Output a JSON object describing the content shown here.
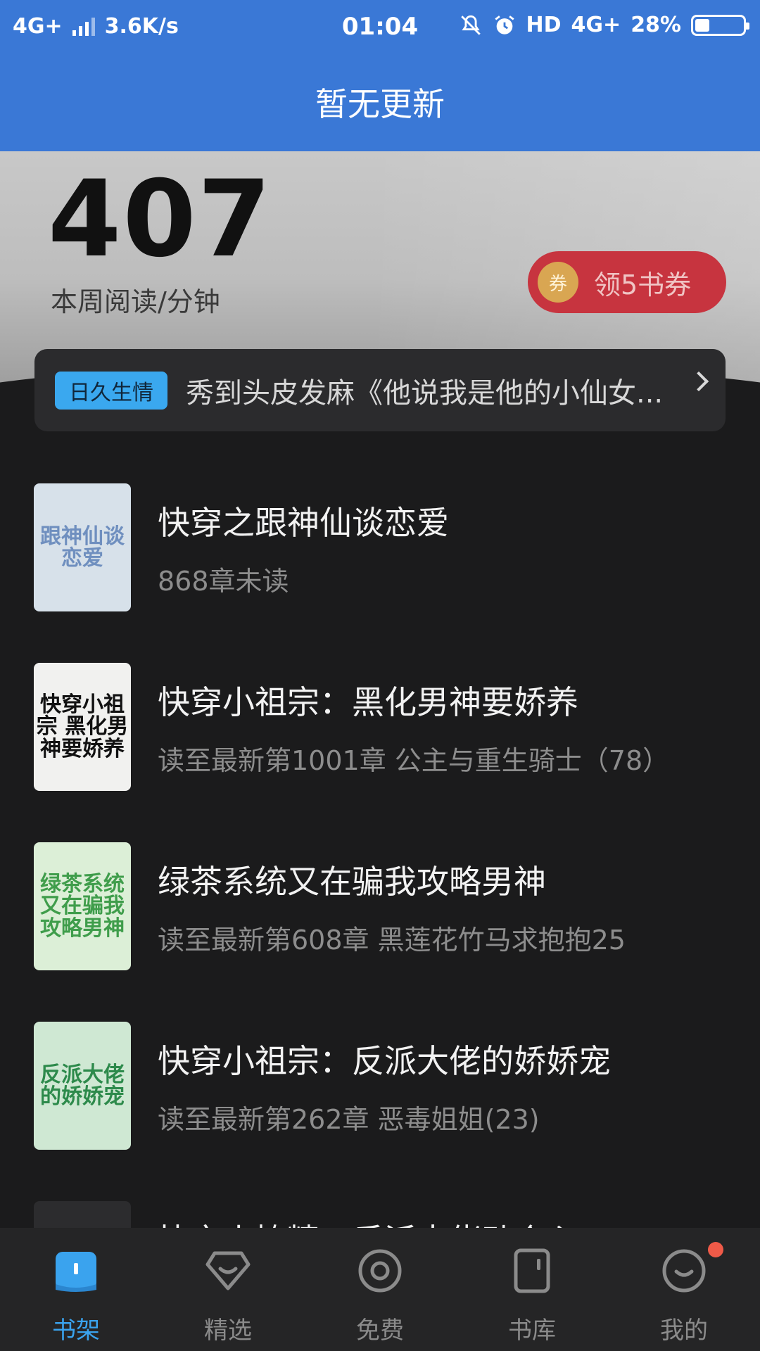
{
  "status_bar": {
    "network": "4G+",
    "speed": "3.6K/s",
    "time": "01:04",
    "hd": "HD",
    "network_right": "4G+",
    "battery": "28%"
  },
  "header": {
    "title": "暂无更新"
  },
  "hero": {
    "minutes": "407",
    "label": "本周阅读/分钟",
    "coupon_icon_text": "券",
    "coupon_label": "领5书券"
  },
  "recommendation": {
    "tag": "日久生情",
    "text": "秀到头皮发麻《他说我是他的小仙女..."
  },
  "books": [
    {
      "title": "快穿之跟神仙谈恋爱",
      "subtitle": "868章未读",
      "cover_text": "跟神仙谈恋爱",
      "cover_bg": "#d7e1ea",
      "cover_fg": "#6f8fbf"
    },
    {
      "title": "快穿小祖宗：黑化男神要娇养",
      "subtitle": "读至最新第1001章 公主与重生骑士（78）",
      "cover_text": "快穿小祖宗 黑化男神要娇养",
      "cover_bg": "#f1f1ef",
      "cover_fg": "#111111"
    },
    {
      "title": "绿茶系统又在骗我攻略男神",
      "subtitle": "读至最新第608章 黑莲花竹马求抱抱25",
      "cover_text": "绿茶系统又在骗我攻略男神",
      "cover_bg": "#dcefd7",
      "cover_fg": "#3f9d4b"
    },
    {
      "title": "快穿小祖宗：反派大佬的娇娇宠",
      "subtitle": "读至最新第262章 恶毒姐姐(23)",
      "cover_text": "反派大佬的娇娇宠",
      "cover_bg": "#cfe8d3",
      "cover_fg": "#2d8a4b"
    },
    {
      "title": "快穿小撩精：反派大佬动个心",
      "subtitle": "",
      "cover_text": "",
      "cover_bg": "#2c2c2e",
      "cover_fg": "#e15a6a"
    }
  ],
  "nav": [
    {
      "label": "书架",
      "icon": "bookshelf-icon",
      "active": true
    },
    {
      "label": "精选",
      "icon": "featured-icon",
      "active": false
    },
    {
      "label": "免费",
      "icon": "free-icon",
      "active": false
    },
    {
      "label": "书库",
      "icon": "library-icon",
      "active": false
    },
    {
      "label": "我的",
      "icon": "profile-icon",
      "active": false
    }
  ],
  "colors": {
    "header": "#3a78d6",
    "accent": "#3aa3ee",
    "coupon": "#c7343f",
    "badge": "#ef5a48"
  }
}
